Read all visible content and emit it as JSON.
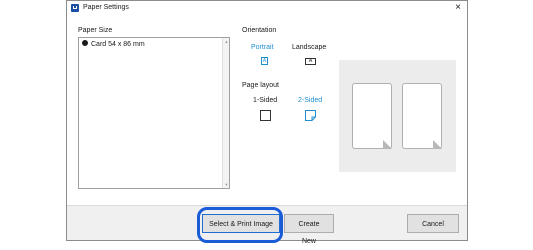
{
  "window": {
    "title": "Paper Settings",
    "close_symbol": "×"
  },
  "paper_size": {
    "label": "Paper Size",
    "items": [
      {
        "label": "Card 54 x 86 mm",
        "selected": true
      }
    ]
  },
  "orientation": {
    "label": "Orientation",
    "options": [
      {
        "label": "Portrait",
        "glyph": "A",
        "selected": true
      },
      {
        "label": "Landscape",
        "glyph": "A",
        "selected": false
      }
    ]
  },
  "page_layout": {
    "label": "Page layout",
    "options": [
      {
        "label": "1-Sided",
        "selected": false
      },
      {
        "label": "2-Sided",
        "selected": true
      }
    ]
  },
  "buttons": {
    "select_print": "Select & Print Image",
    "create_new": "Create New",
    "cancel": "Cancel"
  },
  "colors": {
    "accent": "#1e8fd0",
    "highlight": "#1a5cd8",
    "preview_bg": "#ececec"
  }
}
